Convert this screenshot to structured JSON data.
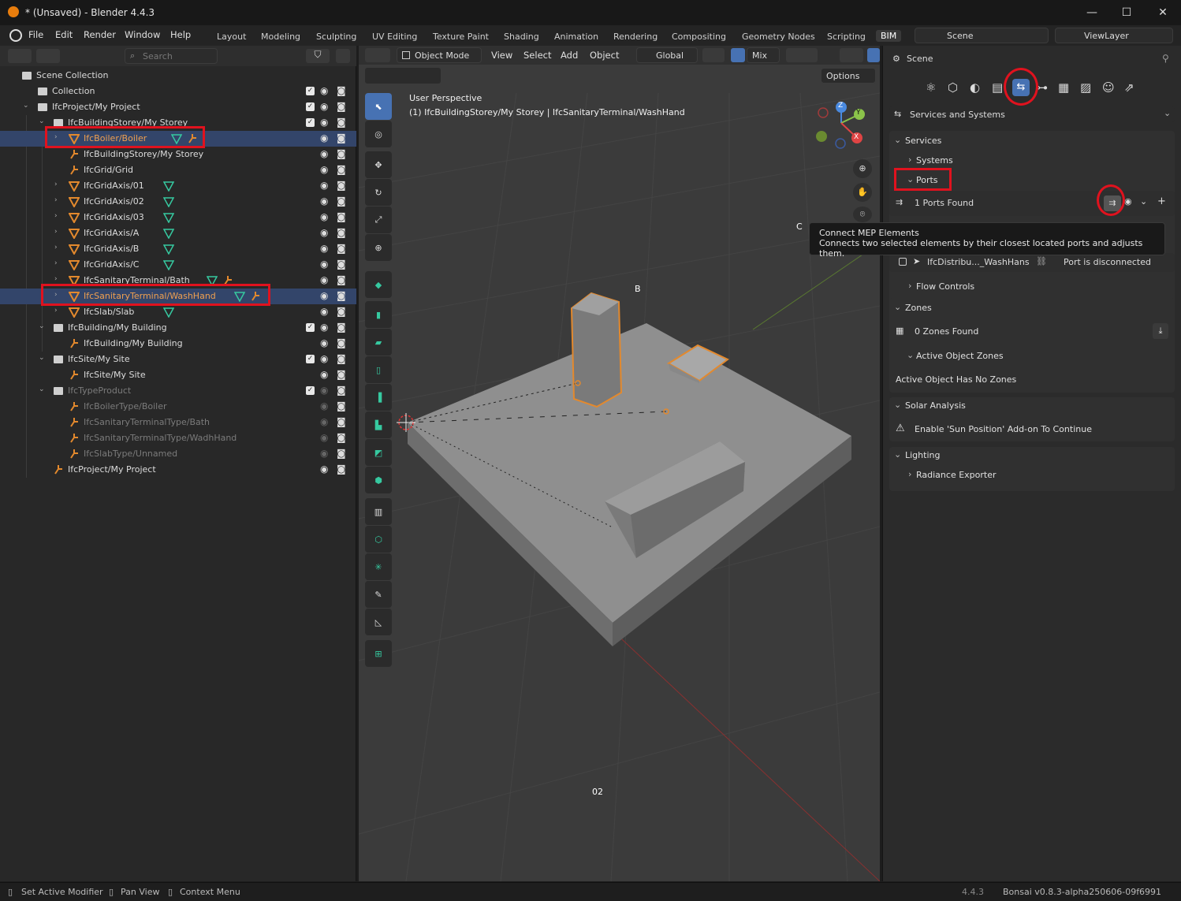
{
  "window": {
    "title": "* (Unsaved) - Blender 4.4.3",
    "minimize": "—",
    "maximize": "☐",
    "close": "✕"
  },
  "menu": {
    "file": "File",
    "edit": "Edit",
    "render": "Render",
    "window": "Window",
    "help": "Help"
  },
  "workspaces": [
    "Layout",
    "Modeling",
    "Sculpting",
    "UV Editing",
    "Texture Paint",
    "Shading",
    "Animation",
    "Rendering",
    "Compositing",
    "Geometry Nodes",
    "Scripting",
    "BIM"
  ],
  "scene_field": "Scene",
  "viewlayer_field": "ViewLayer",
  "outliner": {
    "search_placeholder": "Search",
    "rows": [
      {
        "label": "Scene Collection"
      },
      {
        "label": "Collection"
      },
      {
        "label": "IfcProject/My Project"
      },
      {
        "label": "IfcBuildingStorey/My Storey"
      },
      {
        "label": "IfcBoiler/Boiler"
      },
      {
        "label": "IfcBuildingStorey/My Storey"
      },
      {
        "label": "IfcGrid/Grid"
      },
      {
        "label": "IfcGridAxis/01"
      },
      {
        "label": "IfcGridAxis/02"
      },
      {
        "label": "IfcGridAxis/03"
      },
      {
        "label": "IfcGridAxis/A"
      },
      {
        "label": "IfcGridAxis/B"
      },
      {
        "label": "IfcGridAxis/C"
      },
      {
        "label": "IfcSanitaryTerminal/Bath"
      },
      {
        "label": "IfcSanitaryTerminal/WashHand"
      },
      {
        "label": "IfcSlab/Slab"
      },
      {
        "label": "IfcBuilding/My Building"
      },
      {
        "label": "IfcBuilding/My Building"
      },
      {
        "label": "IfcSite/My Site"
      },
      {
        "label": "IfcSite/My Site"
      },
      {
        "label": "IfcTypeProduct"
      },
      {
        "label": "IfcBoilerType/Boiler"
      },
      {
        "label": "IfcSanitaryTerminalType/Bath"
      },
      {
        "label": "IfcSanitaryTerminalType/WadhHand"
      },
      {
        "label": "IfcSlabType/Unnamed"
      },
      {
        "label": "IfcProject/My Project"
      }
    ]
  },
  "viewport": {
    "mode": "Object Mode",
    "menus": [
      "View",
      "Select",
      "Add",
      "Object"
    ],
    "orientation": "Global",
    "shading": "Mix",
    "options": "Options",
    "overlay_line1": "User Perspective",
    "overlay_line2": "(1) IfcBuildingStorey/My Storey | IfcSanitaryTerminal/WashHand",
    "grid_labels": {
      "b": "B",
      "c": "C",
      "02": "02"
    },
    "gizmo": {
      "x": "X",
      "y": "Y",
      "z": "Z"
    }
  },
  "properties": {
    "context": "Scene",
    "tab_dropdown": "Services and Systems",
    "services": "Services",
    "systems": "Systems",
    "ports": "Ports",
    "ports_found": "1 Ports Found",
    "port_row_name": "IfcDistribu..._WashHans",
    "port_row_status": "Port is disconnected",
    "flow_controls": "Flow Controls",
    "zones": "Zones",
    "zones_found": "0 Zones Found",
    "active_object_zones": "Active Object Zones",
    "no_zones": "Active Object Has No Zones",
    "solar": "Solar Analysis",
    "solar_msg": "Enable 'Sun Position' Add-on To Continue",
    "lighting": "Lighting",
    "radiance": "Radiance Exporter"
  },
  "tooltip": {
    "title": "Connect MEP Elements",
    "body": "Connects two selected elements by their closest located ports and adjusts them."
  },
  "status": {
    "left1": "Set Active Modifier",
    "left2": "Pan View",
    "left3": "Context Menu",
    "version": "4.4.3",
    "bonsai": "Bonsai v0.8.3-alpha250606-09f6991"
  },
  "colors": {
    "accent_selected": "#33456a",
    "highlight_red": "#e0121e",
    "ifc_orange": "#e3892d",
    "mesh_green": "#36c9a0"
  }
}
